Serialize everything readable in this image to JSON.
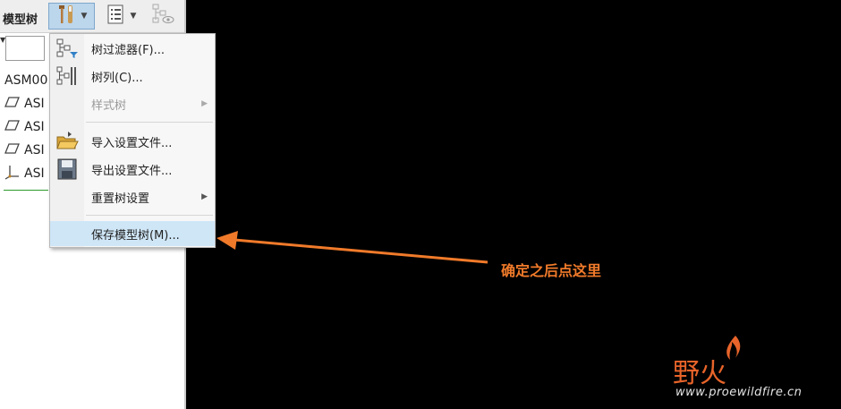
{
  "panel": {
    "title": "模型树",
    "tree_items": [
      {
        "label": "ASM00",
        "icon": "assembly-icon"
      },
      {
        "label": "ASI",
        "icon": "datum-plane-icon"
      },
      {
        "label": "ASI",
        "icon": "datum-plane-icon"
      },
      {
        "label": "ASI",
        "icon": "datum-plane-icon"
      },
      {
        "label": "ASI",
        "icon": "coordinate-system-icon"
      }
    ]
  },
  "menu": {
    "items": [
      {
        "label": "树过滤器(F)...",
        "icon": "tree-filter-icon",
        "disabled": false,
        "submenu": false
      },
      {
        "label": "树列(C)...",
        "icon": "tree-columns-icon",
        "disabled": false,
        "submenu": false
      },
      {
        "label": "样式树",
        "icon": "",
        "disabled": true,
        "submenu": true
      },
      {
        "label": "导入设置文件...",
        "icon": "open-folder-icon",
        "disabled": false,
        "submenu": false
      },
      {
        "label": "导出设置文件...",
        "icon": "save-disk-icon",
        "disabled": false,
        "submenu": false
      },
      {
        "label": "重置树设置",
        "icon": "",
        "disabled": false,
        "submenu": true
      },
      {
        "label": "保存模型树(M)...",
        "icon": "",
        "disabled": false,
        "submenu": false,
        "highlighted": true
      }
    ]
  },
  "annotation": {
    "text": "确定之后点这里",
    "color": "#f07a2a"
  },
  "watermark": {
    "logo_text": "野火",
    "url": "www.proewildfire.cn"
  },
  "colors": {
    "highlight": "#cfe6f7",
    "arrow": "#f07a2a",
    "background": "#000000"
  }
}
